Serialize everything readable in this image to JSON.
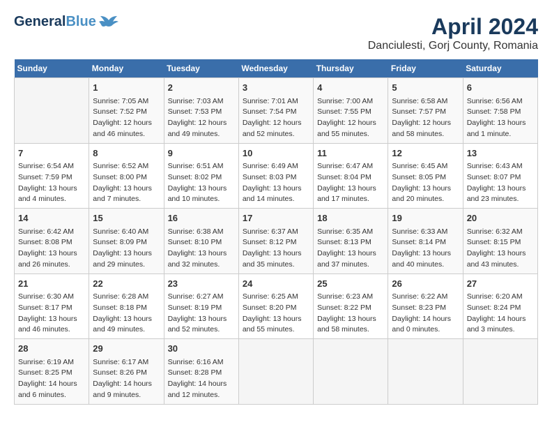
{
  "header": {
    "logo_general": "General",
    "logo_blue": "Blue",
    "title": "April 2024",
    "subtitle": "Danciulesti, Gorj County, Romania"
  },
  "weekdays": [
    "Sunday",
    "Monday",
    "Tuesday",
    "Wednesday",
    "Thursday",
    "Friday",
    "Saturday"
  ],
  "weeks": [
    [
      {
        "day": "",
        "sunrise": "",
        "sunset": "",
        "daylight": ""
      },
      {
        "day": "1",
        "sunrise": "Sunrise: 7:05 AM",
        "sunset": "Sunset: 7:52 PM",
        "daylight": "Daylight: 12 hours and 46 minutes."
      },
      {
        "day": "2",
        "sunrise": "Sunrise: 7:03 AM",
        "sunset": "Sunset: 7:53 PM",
        "daylight": "Daylight: 12 hours and 49 minutes."
      },
      {
        "day": "3",
        "sunrise": "Sunrise: 7:01 AM",
        "sunset": "Sunset: 7:54 PM",
        "daylight": "Daylight: 12 hours and 52 minutes."
      },
      {
        "day": "4",
        "sunrise": "Sunrise: 7:00 AM",
        "sunset": "Sunset: 7:55 PM",
        "daylight": "Daylight: 12 hours and 55 minutes."
      },
      {
        "day": "5",
        "sunrise": "Sunrise: 6:58 AM",
        "sunset": "Sunset: 7:57 PM",
        "daylight": "Daylight: 12 hours and 58 minutes."
      },
      {
        "day": "6",
        "sunrise": "Sunrise: 6:56 AM",
        "sunset": "Sunset: 7:58 PM",
        "daylight": "Daylight: 13 hours and 1 minute."
      }
    ],
    [
      {
        "day": "7",
        "sunrise": "Sunrise: 6:54 AM",
        "sunset": "Sunset: 7:59 PM",
        "daylight": "Daylight: 13 hours and 4 minutes."
      },
      {
        "day": "8",
        "sunrise": "Sunrise: 6:52 AM",
        "sunset": "Sunset: 8:00 PM",
        "daylight": "Daylight: 13 hours and 7 minutes."
      },
      {
        "day": "9",
        "sunrise": "Sunrise: 6:51 AM",
        "sunset": "Sunset: 8:02 PM",
        "daylight": "Daylight: 13 hours and 10 minutes."
      },
      {
        "day": "10",
        "sunrise": "Sunrise: 6:49 AM",
        "sunset": "Sunset: 8:03 PM",
        "daylight": "Daylight: 13 hours and 14 minutes."
      },
      {
        "day": "11",
        "sunrise": "Sunrise: 6:47 AM",
        "sunset": "Sunset: 8:04 PM",
        "daylight": "Daylight: 13 hours and 17 minutes."
      },
      {
        "day": "12",
        "sunrise": "Sunrise: 6:45 AM",
        "sunset": "Sunset: 8:05 PM",
        "daylight": "Daylight: 13 hours and 20 minutes."
      },
      {
        "day": "13",
        "sunrise": "Sunrise: 6:43 AM",
        "sunset": "Sunset: 8:07 PM",
        "daylight": "Daylight: 13 hours and 23 minutes."
      }
    ],
    [
      {
        "day": "14",
        "sunrise": "Sunrise: 6:42 AM",
        "sunset": "Sunset: 8:08 PM",
        "daylight": "Daylight: 13 hours and 26 minutes."
      },
      {
        "day": "15",
        "sunrise": "Sunrise: 6:40 AM",
        "sunset": "Sunset: 8:09 PM",
        "daylight": "Daylight: 13 hours and 29 minutes."
      },
      {
        "day": "16",
        "sunrise": "Sunrise: 6:38 AM",
        "sunset": "Sunset: 8:10 PM",
        "daylight": "Daylight: 13 hours and 32 minutes."
      },
      {
        "day": "17",
        "sunrise": "Sunrise: 6:37 AM",
        "sunset": "Sunset: 8:12 PM",
        "daylight": "Daylight: 13 hours and 35 minutes."
      },
      {
        "day": "18",
        "sunrise": "Sunrise: 6:35 AM",
        "sunset": "Sunset: 8:13 PM",
        "daylight": "Daylight: 13 hours and 37 minutes."
      },
      {
        "day": "19",
        "sunrise": "Sunrise: 6:33 AM",
        "sunset": "Sunset: 8:14 PM",
        "daylight": "Daylight: 13 hours and 40 minutes."
      },
      {
        "day": "20",
        "sunrise": "Sunrise: 6:32 AM",
        "sunset": "Sunset: 8:15 PM",
        "daylight": "Daylight: 13 hours and 43 minutes."
      }
    ],
    [
      {
        "day": "21",
        "sunrise": "Sunrise: 6:30 AM",
        "sunset": "Sunset: 8:17 PM",
        "daylight": "Daylight: 13 hours and 46 minutes."
      },
      {
        "day": "22",
        "sunrise": "Sunrise: 6:28 AM",
        "sunset": "Sunset: 8:18 PM",
        "daylight": "Daylight: 13 hours and 49 minutes."
      },
      {
        "day": "23",
        "sunrise": "Sunrise: 6:27 AM",
        "sunset": "Sunset: 8:19 PM",
        "daylight": "Daylight: 13 hours and 52 minutes."
      },
      {
        "day": "24",
        "sunrise": "Sunrise: 6:25 AM",
        "sunset": "Sunset: 8:20 PM",
        "daylight": "Daylight: 13 hours and 55 minutes."
      },
      {
        "day": "25",
        "sunrise": "Sunrise: 6:23 AM",
        "sunset": "Sunset: 8:22 PM",
        "daylight": "Daylight: 13 hours and 58 minutes."
      },
      {
        "day": "26",
        "sunrise": "Sunrise: 6:22 AM",
        "sunset": "Sunset: 8:23 PM",
        "daylight": "Daylight: 14 hours and 0 minutes."
      },
      {
        "day": "27",
        "sunrise": "Sunrise: 6:20 AM",
        "sunset": "Sunset: 8:24 PM",
        "daylight": "Daylight: 14 hours and 3 minutes."
      }
    ],
    [
      {
        "day": "28",
        "sunrise": "Sunrise: 6:19 AM",
        "sunset": "Sunset: 8:25 PM",
        "daylight": "Daylight: 14 hours and 6 minutes."
      },
      {
        "day": "29",
        "sunrise": "Sunrise: 6:17 AM",
        "sunset": "Sunset: 8:26 PM",
        "daylight": "Daylight: 14 hours and 9 minutes."
      },
      {
        "day": "30",
        "sunrise": "Sunrise: 6:16 AM",
        "sunset": "Sunset: 8:28 PM",
        "daylight": "Daylight: 14 hours and 12 minutes."
      },
      {
        "day": "",
        "sunrise": "",
        "sunset": "",
        "daylight": ""
      },
      {
        "day": "",
        "sunrise": "",
        "sunset": "",
        "daylight": ""
      },
      {
        "day": "",
        "sunrise": "",
        "sunset": "",
        "daylight": ""
      },
      {
        "day": "",
        "sunrise": "",
        "sunset": "",
        "daylight": ""
      }
    ]
  ]
}
